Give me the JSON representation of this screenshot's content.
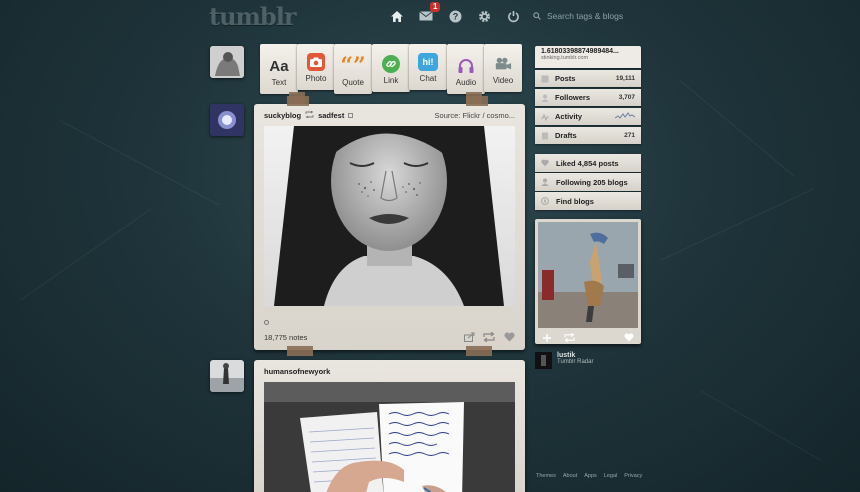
{
  "header": {
    "logo": "tumblr",
    "message_badge": "1",
    "search_placeholder": "Search tags & blogs"
  },
  "icons": [
    "home-icon",
    "mail-icon",
    "help-icon",
    "gear-icon",
    "power-icon",
    "search-icon"
  ],
  "post_types": [
    {
      "label": "Text",
      "glyph": "Aa",
      "color": "#333333"
    },
    {
      "label": "Photo",
      "glyph": "",
      "color": "#e05a3a"
    },
    {
      "label": "Quote",
      "glyph": "“”",
      "color": "#e08a2a"
    },
    {
      "label": "Link",
      "glyph": "",
      "color": "#4caf50"
    },
    {
      "label": "Chat",
      "glyph": "hi!",
      "color": "#3ea6dd"
    },
    {
      "label": "Audio",
      "glyph": "",
      "color": "#9b59b6"
    },
    {
      "label": "Video",
      "glyph": "",
      "color": "#7f8c8d"
    }
  ],
  "posts": [
    {
      "author": "suckyblog",
      "reblogged_from": "sadfest",
      "source_label": "Source:",
      "source_value": "Flickr / cosmo...",
      "notes": "18,775 notes"
    },
    {
      "author": "humansofnewyork"
    }
  ],
  "sidebar": {
    "blog_title": "1.61803398874989484...",
    "blog_url": "stinking.tumblr.com",
    "stats": [
      {
        "label": "Posts",
        "count": "19,111"
      },
      {
        "label": "Followers",
        "count": "3,707"
      },
      {
        "label": "Activity",
        "count": ""
      },
      {
        "label": "Drafts",
        "count": "271"
      }
    ],
    "links": [
      {
        "label": "Liked 4,854 posts"
      },
      {
        "label": "Following 205 blogs"
      },
      {
        "label": "Find blogs"
      }
    ],
    "radar_author": "lustik",
    "radar_label": "Tumblr Radar"
  },
  "footer": [
    "Themes",
    "About",
    "Apps",
    "Legal",
    "Privacy"
  ],
  "colors": {
    "background": "#1f353b",
    "card": "#e9e5df",
    "badge": "#c9302c"
  }
}
